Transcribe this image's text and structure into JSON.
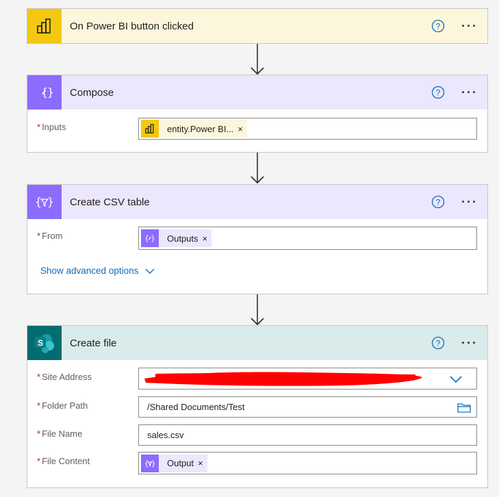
{
  "trigger": {
    "title": "On Power BI button clicked",
    "header_color": "#fcf7dc",
    "icon": "power-bi-icon",
    "icon_color": "#f2c811"
  },
  "compose": {
    "title": "Compose",
    "header_color": "#ece7fc",
    "icon": "compose-icon",
    "icon_color": "#8c6cff",
    "fields": [
      {
        "label": "Inputs",
        "required": true,
        "token": "entity.Power BI...",
        "token_icon": "power-bi-icon"
      }
    ]
  },
  "csv": {
    "title": "Create CSV table",
    "header_color": "#ece7fc",
    "icon": "csv-table-icon",
    "icon_color": "#8c6cff",
    "fields": [
      {
        "label": "From",
        "required": true,
        "token": "Outputs",
        "token_icon": "compose-icon"
      }
    ],
    "advanced_link": "Show advanced options"
  },
  "create_file": {
    "title": "Create file",
    "header_color": "#d9ebeb",
    "icon": "sharepoint-icon",
    "icon_color": "#036c70",
    "fields": [
      {
        "label": "Site Address",
        "required": true,
        "value": "",
        "redacted": true
      },
      {
        "label": "Folder Path",
        "required": true,
        "value": "/Shared Documents/Test"
      },
      {
        "label": "File Name",
        "required": true,
        "value": "sales.csv"
      },
      {
        "label": "File Content",
        "required": true,
        "token": "Output",
        "token_icon": "csv-table-icon"
      }
    ]
  },
  "required_marker": "*",
  "close_glyph": "×",
  "more_glyph": "···"
}
